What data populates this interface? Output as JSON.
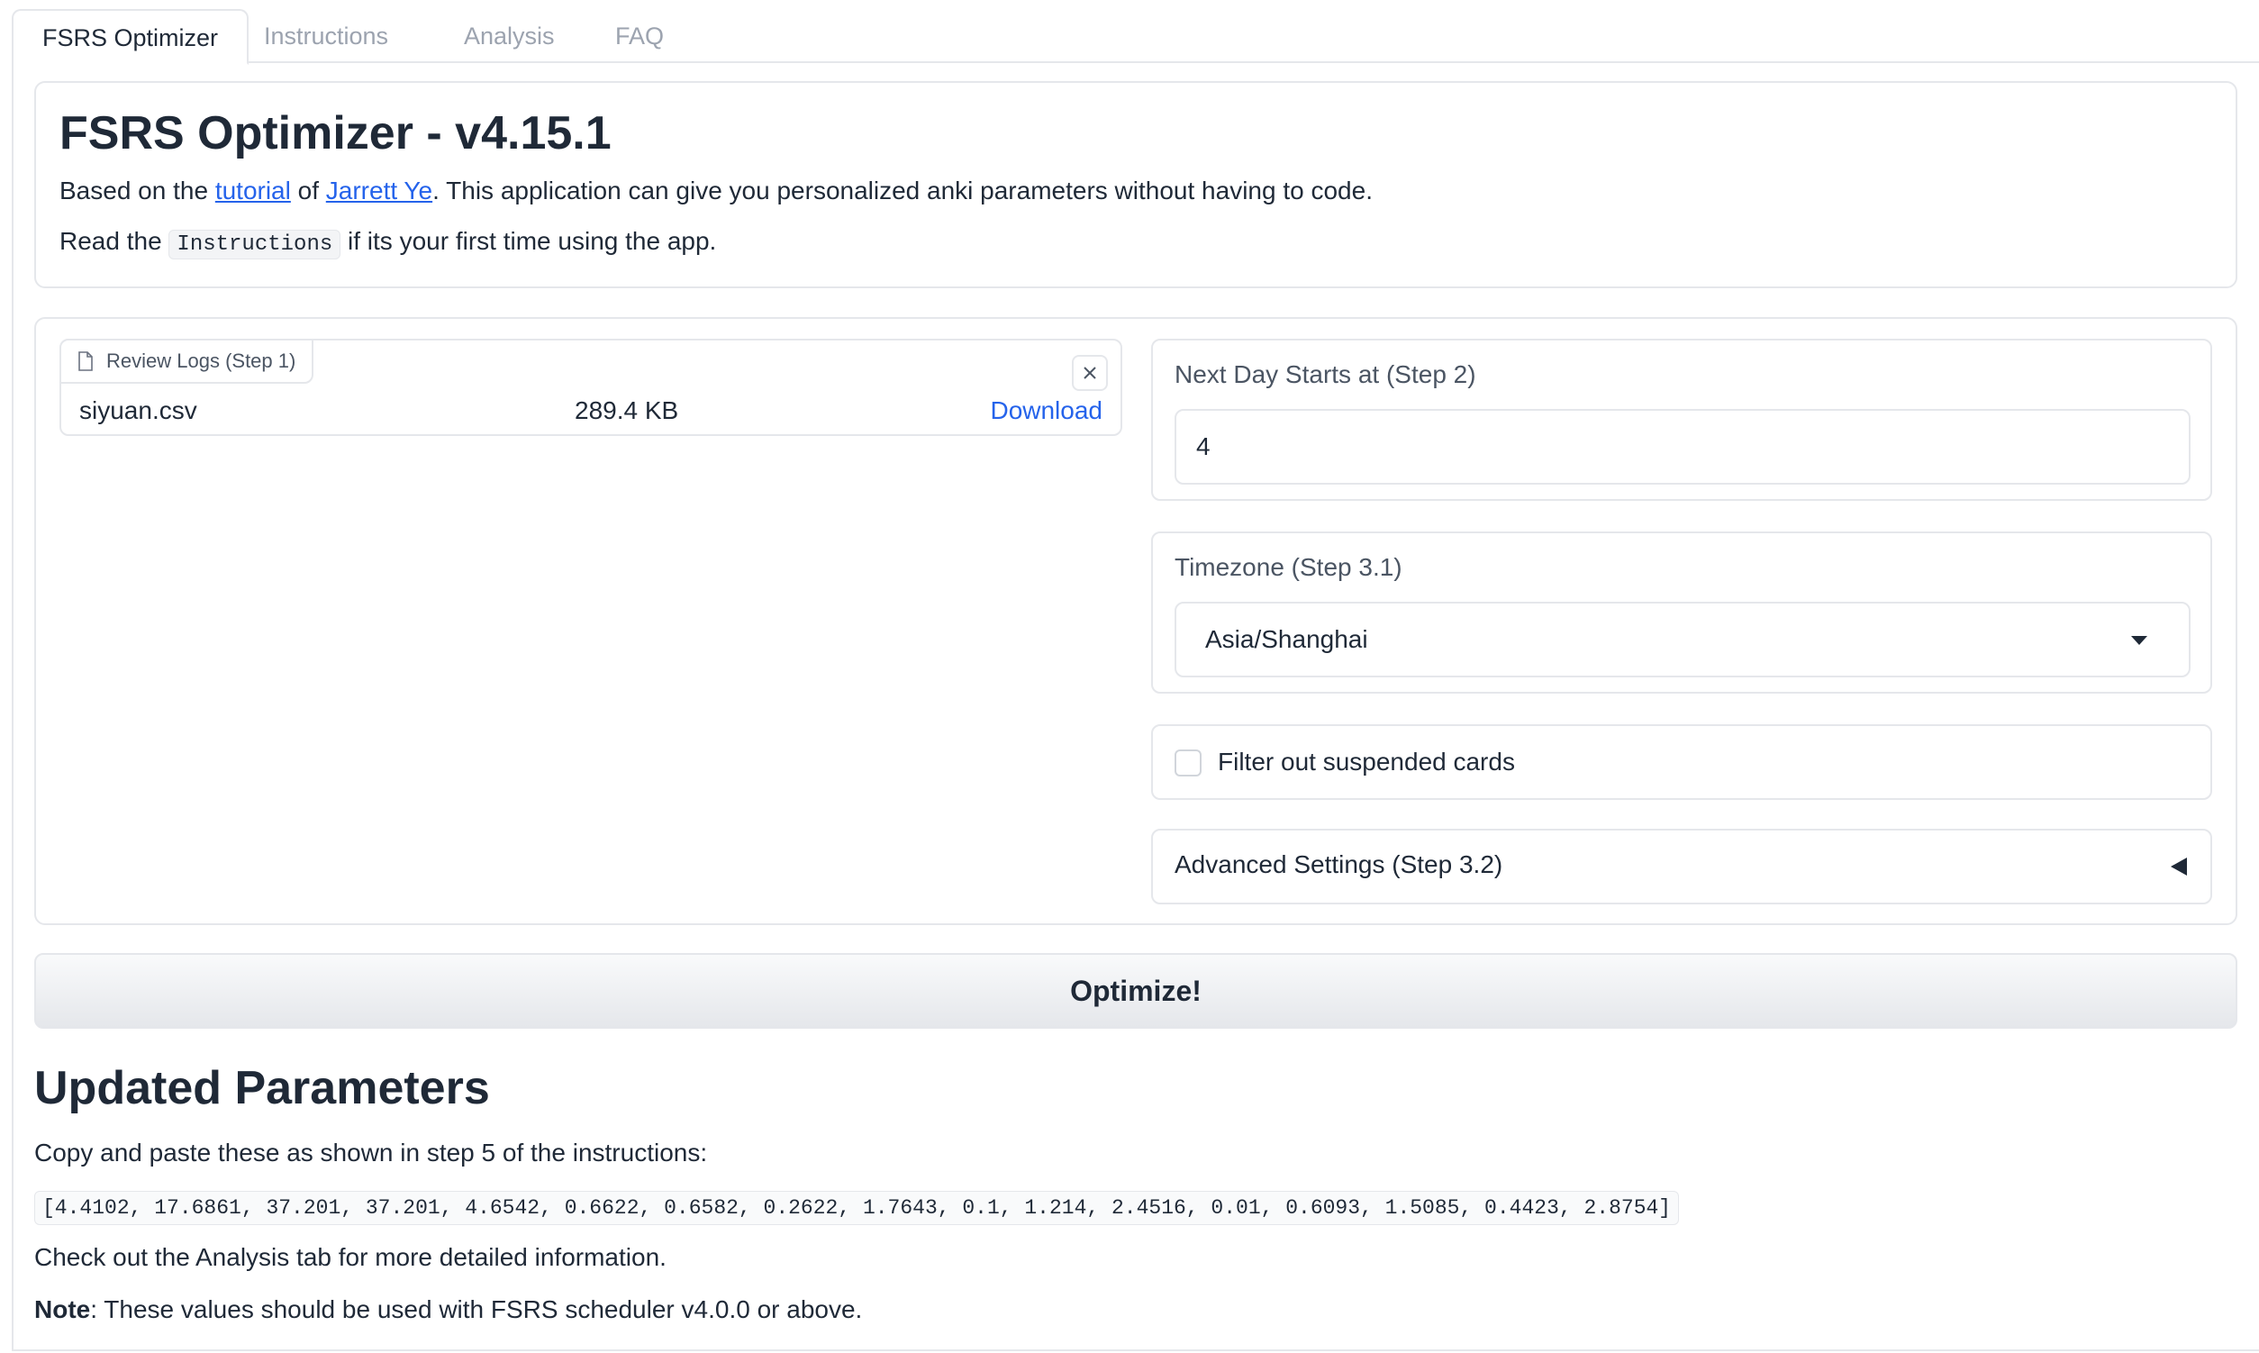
{
  "tabs": [
    {
      "label": "FSRS Optimizer",
      "active": true
    },
    {
      "label": "Instructions",
      "active": false
    },
    {
      "label": "Analysis",
      "active": false
    },
    {
      "label": "FAQ",
      "active": false
    }
  ],
  "header": {
    "title": "FSRS Optimizer - v4.15.1",
    "line1_prefix": "Based on the ",
    "line1_link1": "tutorial",
    "line1_mid": " of ",
    "line1_link2": "Jarrett Ye",
    "line1_suffix": ". This application can give you personalized anki parameters without having to code.",
    "line2_prefix": "Read the ",
    "line2_code": "Instructions",
    "line2_suffix": " if its your first time using the app."
  },
  "upload": {
    "label": "Review Logs (Step 1)",
    "file_name": "siyuan.csv",
    "file_size": "289.4 KB",
    "download_label": "Download"
  },
  "next_day": {
    "label": "Next Day Starts at (Step 2)",
    "value": "4"
  },
  "timezone": {
    "label": "Timezone (Step 3.1)",
    "value": "Asia/Shanghai"
  },
  "filter": {
    "label": "Filter out suspended cards",
    "checked": false
  },
  "advanced": {
    "label": "Advanced Settings (Step 3.2)"
  },
  "optimize_label": "Optimize!",
  "results": {
    "title": "Updated Parameters",
    "intro": "Copy and paste these as shown in step 5 of the instructions:",
    "params": "[4.4102, 17.6861, 37.201, 37.201, 4.6542, 0.6622, 0.6582, 0.2622, 1.7643, 0.1, 1.214, 2.4516, 0.01, 0.6093, 1.5085, 0.4423, 2.8754]",
    "analysis_note": "Check out the Analysis tab for more detailed information.",
    "note_bold": "Note",
    "note_text": ": These values should be used with FSRS scheduler v4.0.0 or above."
  }
}
